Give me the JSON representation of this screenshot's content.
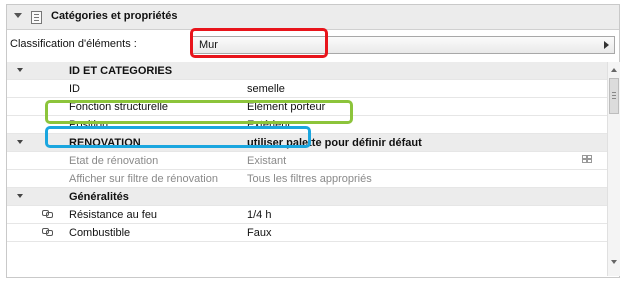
{
  "header": {
    "title": "Catégories et propriétés",
    "collapse_icon": "triangle-down-icon",
    "panel_icon": "document-list-icon"
  },
  "classification": {
    "label": "Classification d'éléments :",
    "value": "Mur",
    "arrow_icon": "triangle-right-icon"
  },
  "rows": [
    {
      "type": "group",
      "label": "ID ET CATEGORIES",
      "value": ""
    },
    {
      "type": "item",
      "label": "ID",
      "value": "semelle"
    },
    {
      "type": "item",
      "label": "Fonction structurelle",
      "value": "Elément porteur"
    },
    {
      "type": "item",
      "label": "Position",
      "value": "Extérieur"
    },
    {
      "type": "group",
      "label": "RENOVATION",
      "value": "utiliser palette pour définir défaut"
    },
    {
      "type": "item",
      "dim": true,
      "label": "Etat de rénovation",
      "value": "Existant",
      "icon": "grid-icon"
    },
    {
      "type": "item",
      "dim": true,
      "label": "Afficher sur filtre de rénovation",
      "value": "Tous les filtres appropriés"
    },
    {
      "type": "group",
      "label": "Généralités",
      "value": ""
    },
    {
      "type": "item",
      "link": true,
      "label": "Résistance au feu",
      "value": "1/4 h"
    },
    {
      "type": "item",
      "link": true,
      "label": "Combustible",
      "value": "Faux"
    }
  ],
  "highlights": {
    "red": "#e8141b",
    "green": "#8cc43b",
    "blue": "#1aa6df"
  }
}
